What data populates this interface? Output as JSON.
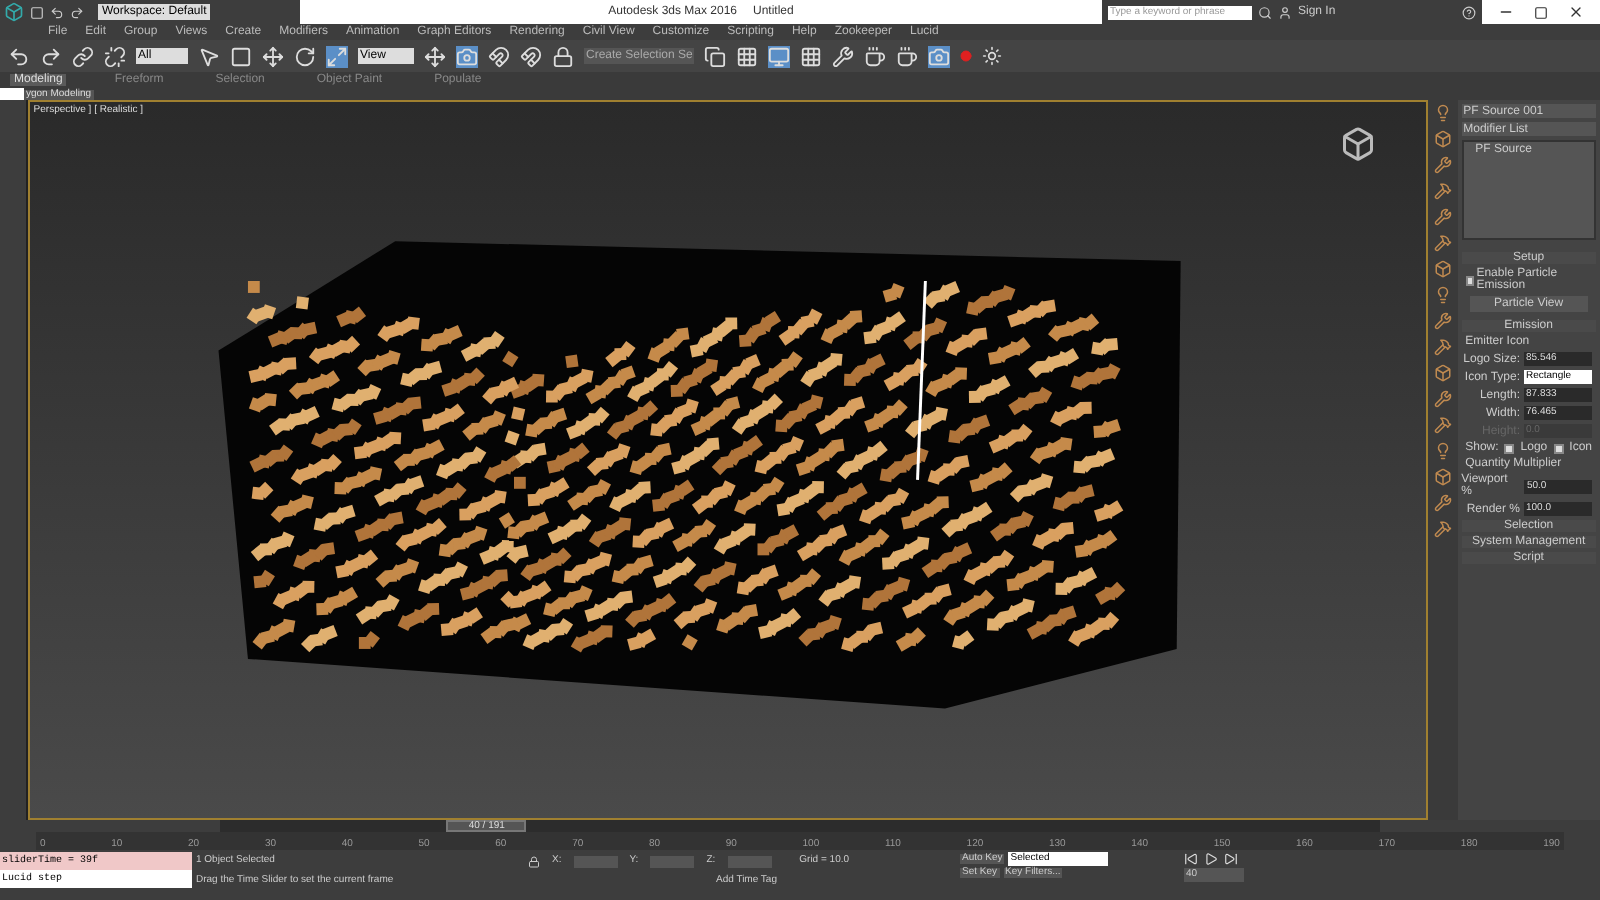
{
  "title_bar": {
    "workspace": "Workspace: Default",
    "app_title": "Autodesk 3ds Max 2016",
    "document": "Untitled",
    "search": {
      "placeholder": "Type a keyword or phrase"
    },
    "sign_in": "Sign In"
  },
  "menu": [
    "File",
    "Edit",
    "Group",
    "Views",
    "Create",
    "Modifiers",
    "Animation",
    "Graph Editors",
    "Rendering",
    "Civil View",
    "Customize",
    "Scripting",
    "Help",
    "Zookeeper",
    "Lucid"
  ],
  "toolbar": {
    "filter": "All",
    "coordinate": "View",
    "selection_set": "Create Selection Se"
  },
  "ribbon_tabs": [
    {
      "label": "Modeling",
      "selected": true
    },
    {
      "label": "Freeform",
      "selected": false
    },
    {
      "label": "Selection",
      "selected": false
    },
    {
      "label": "Object Paint",
      "selected": false
    },
    {
      "label": "Populate",
      "selected": false
    }
  ],
  "ribbon_panel": "ygon Modeling",
  "viewport": {
    "label": "Perspective ] [ Realistic ]"
  },
  "command_panel": {
    "object_name": "PF Source 001",
    "modifier_list": "Modifier List",
    "stack": [
      "PF Source"
    ],
    "setup": {
      "title": "Setup",
      "enable_emission": {
        "label": "Enable Particle Emission",
        "checked": true
      },
      "particle_view": "Particle View"
    },
    "emission": {
      "title": "Emission",
      "group": "Emitter Icon",
      "fields": [
        {
          "label": "Logo Size:",
          "value": "85.546",
          "disabled": false
        },
        {
          "label": "Icon Type:",
          "value": "Rectangle",
          "disabled": false,
          "kind": "dropdown"
        },
        {
          "label": "Length:",
          "value": "87.833",
          "disabled": false
        },
        {
          "label": "Width:",
          "value": "76.465",
          "disabled": false
        },
        {
          "label": "Height:",
          "value": "0.0",
          "disabled": true
        }
      ],
      "show_label": "Show:",
      "show": [
        {
          "label": "Logo",
          "checked": true
        },
        {
          "label": "Icon",
          "checked": true
        }
      ],
      "quantity_group": "Quantity Multiplier",
      "quantity": [
        {
          "label": "Viewport %",
          "value": "50.0"
        },
        {
          "label": "Render %",
          "value": "100.0"
        }
      ]
    },
    "rollouts": [
      "Selection",
      "System Management",
      "Script"
    ]
  },
  "timeline": {
    "frame": "40 / 191",
    "level": 0.21,
    "ticks": [
      "0",
      "10",
      "20",
      "30",
      "40",
      "50",
      "60",
      "70",
      "80",
      "90",
      "100",
      "110",
      "120",
      "130",
      "140",
      "150",
      "160",
      "170",
      "180",
      "190"
    ]
  },
  "listener": [
    "sliderTime = 39f",
    "Lucid step"
  ],
  "status": {
    "selection": "1 Object Selected",
    "prompt": "Drag the Time Slider to set the current frame",
    "x": "X:",
    "y": "Y:",
    "z": "Z:",
    "grid": "Grid = 10.0",
    "add_time_tag": "Add Time Tag",
    "auto_key": "Auto Key",
    "key_mode": "Selected",
    "set_key": "Set Key",
    "key_filters": "Key Filters...",
    "current_frame": "40"
  }
}
